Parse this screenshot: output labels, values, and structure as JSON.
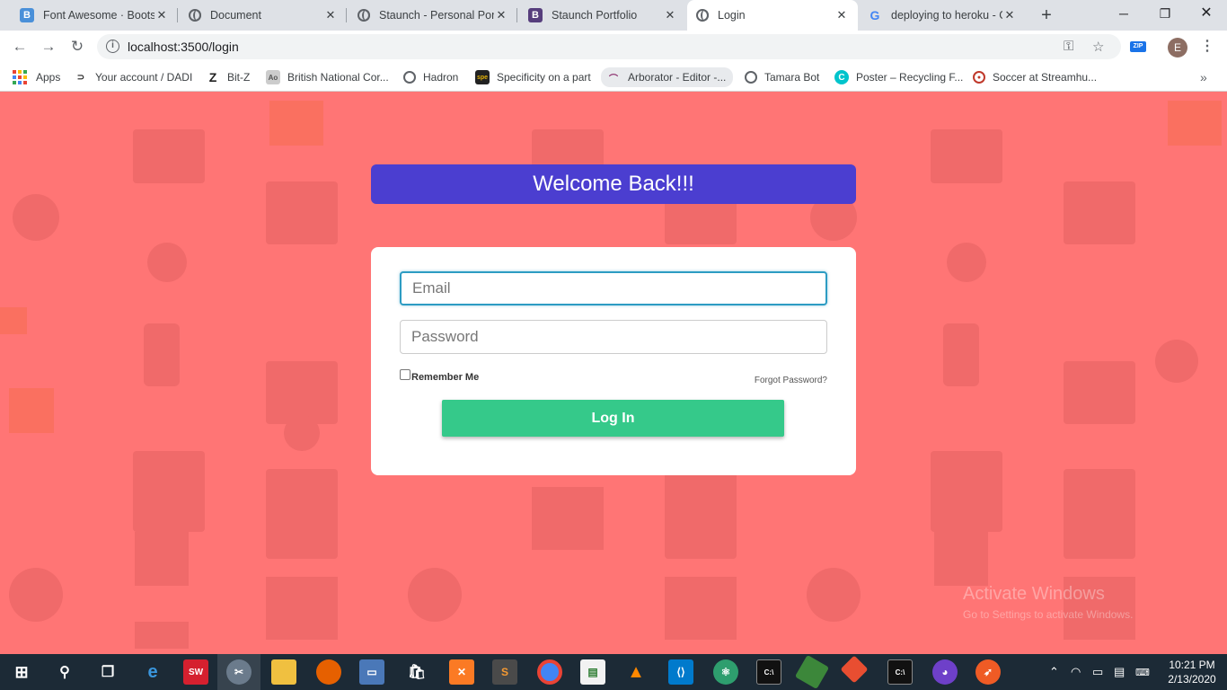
{
  "browser": {
    "tabs": [
      {
        "title": "Font Awesome · Bootstr",
        "favicon": "bootstrap-b-icon",
        "active": false
      },
      {
        "title": "Document",
        "favicon": "globe-icon",
        "active": false
      },
      {
        "title": "Staunch - Personal Port",
        "favicon": "globe-icon",
        "active": false
      },
      {
        "title": "Staunch Portfolio",
        "favicon": "bootstrap-b-icon",
        "active": false
      },
      {
        "title": "Login",
        "favicon": "globe-icon",
        "active": true
      },
      {
        "title": "deploying to heroku - G",
        "favicon": "google-icon",
        "active": false
      }
    ],
    "url": "localhost:3500/login",
    "profile_initial": "E",
    "extension_label": "ZIP",
    "bookmarks": [
      {
        "label": "Apps",
        "icon": "apps-grid-icon"
      },
      {
        "label": "Your account / DADI",
        "icon": "dadi-icon"
      },
      {
        "label": "Bit-Z",
        "icon": "bitz-icon"
      },
      {
        "label": "British National Cor...",
        "icon": "bnc-icon"
      },
      {
        "label": "Hadron",
        "icon": "globe-icon"
      },
      {
        "label": "Specificity on a part",
        "icon": "specificity-icon"
      },
      {
        "label": "Arborator - Editor -...",
        "icon": "arborator-icon"
      },
      {
        "label": "Tamara Bot",
        "icon": "globe-icon"
      },
      {
        "label": "Poster – Recycling F...",
        "icon": "canva-icon"
      },
      {
        "label": "Soccer at Streamhu...",
        "icon": "streamhub-icon"
      }
    ]
  },
  "page": {
    "heading": "Welcome Back!!!",
    "email_placeholder": "Email",
    "password_placeholder": "Password",
    "remember_label": "Remember Me",
    "forgot_label": "Forgot Password?",
    "login_label": "Log In",
    "watermark_line1": "Activate Windows",
    "watermark_line2": "Go to Settings to activate Windows.",
    "colors": {
      "background": "#ff7575",
      "heading_bg": "#4b3ed0",
      "button_bg": "#35c98a",
      "focus_border": "#2d9cc3"
    }
  },
  "taskbar": {
    "apps": [
      "start-icon",
      "search-icon",
      "task-view-icon",
      "edge-icon",
      "solidworks-icon",
      "snipping-tool-icon",
      "file-explorer-icon",
      "firefox-icon",
      "remote-desktop-icon",
      "store-icon",
      "xampp-icon",
      "sublime-text-icon",
      "chrome-icon",
      "spreadsheet-icon",
      "vlc-icon",
      "vscode-icon",
      "atom-icon",
      "terminal-icon",
      "nodejs-icon",
      "git-icon",
      "terminal-icon",
      "github-desktop-icon",
      "postman-icon"
    ],
    "time": "10:21 PM",
    "date": "2/13/2020"
  }
}
